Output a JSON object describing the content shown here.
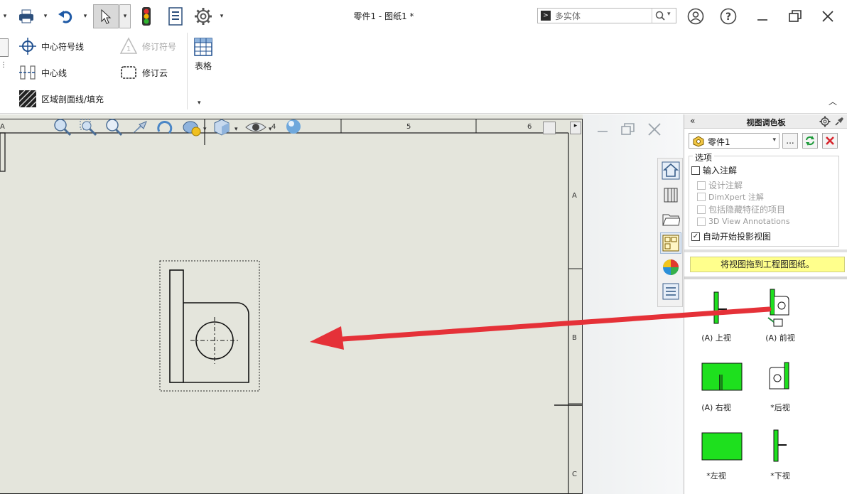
{
  "titlebar": {
    "document_title": "零件1 - 图纸1 *",
    "search_placeholder": "多实体"
  },
  "ribbon": {
    "items": {
      "center_mark": "中心符号线",
      "center_line": "中心线",
      "area_hatch": "区域剖面线/填充",
      "revision_symbol": "修订符号",
      "revision_cloud": "修订云",
      "table": "表格"
    }
  },
  "canvas": {
    "ruler_numbers": [
      "4",
      "5",
      "6"
    ],
    "border_letters": [
      "A",
      "B",
      "C"
    ]
  },
  "palette": {
    "title": "视图调色板",
    "part_selected": "零件1",
    "browse_label": "...",
    "options_legend": "选项",
    "options": {
      "import_annotations": "输入注解",
      "design_annotations": "设计注解",
      "dimxpert_annotations": "DimXpert 注解",
      "include_hidden": "包括隐藏特征的项目",
      "view_annotations_3d": "3D View Annotations",
      "auto_projected": "自动开始投影视图"
    },
    "hint": "将视图拖到工程图图纸。",
    "views": {
      "top": "(A) 上视",
      "front": "(A) 前视",
      "right": "(A) 右视",
      "back": "*后视",
      "left": "*左视",
      "bottom": "*下视"
    }
  },
  "colors": {
    "accent": "#e53138",
    "thumb_green": "#1ee01e",
    "hint_yellow": "#ffff8c",
    "sheet_bg": "#e4e5dc"
  }
}
